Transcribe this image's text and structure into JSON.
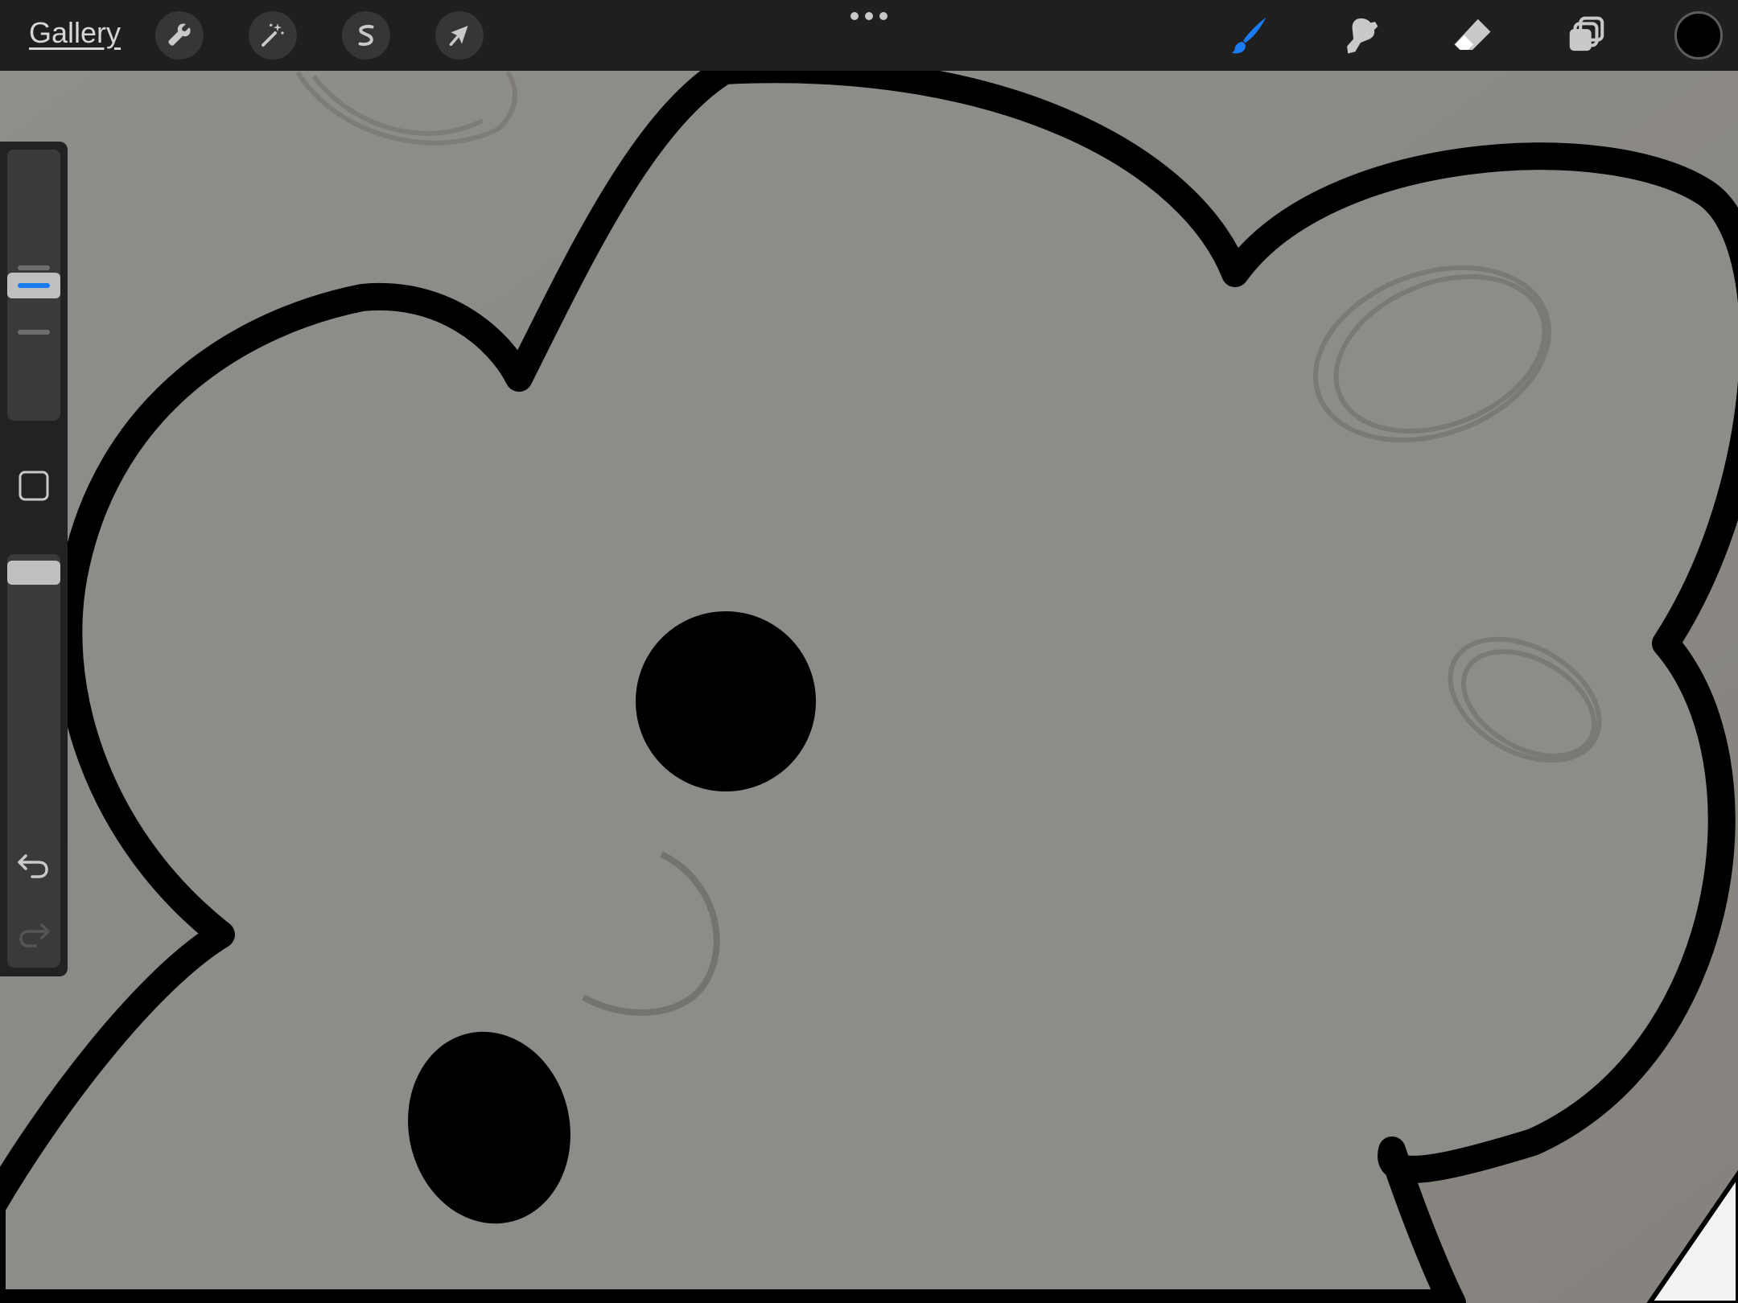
{
  "toolbar": {
    "gallery_label": "Gallery",
    "left_tools": [
      {
        "name": "actions",
        "icon": "wrench-icon"
      },
      {
        "name": "adjustments",
        "icon": "magic-wand-icon"
      },
      {
        "name": "selection",
        "icon": "selection-s-icon"
      },
      {
        "name": "transform",
        "icon": "arrow-cursor-icon"
      }
    ],
    "more_icon": "ellipsis-icon",
    "right_tools": [
      {
        "name": "brush",
        "icon": "brush-icon",
        "active": true
      },
      {
        "name": "smudge",
        "icon": "smudge-icon",
        "active": false
      },
      {
        "name": "eraser",
        "icon": "eraser-icon",
        "active": false
      },
      {
        "name": "layers",
        "icon": "layers-icon",
        "active": false
      }
    ],
    "current_color": "#000000"
  },
  "sidebar": {
    "brush_size_level": 0.5,
    "brush_opacity_level": 1.0,
    "modify_icon": "square-icon",
    "undo_icon": "undo-arrow-icon",
    "redo_icon": "redo-arrow-icon"
  },
  "colors": {
    "accent": "#1a7cf5",
    "toolbar_bg": "#1f1f1f",
    "sidebar_bg": "#222222",
    "canvas_paper": "#8c8a86",
    "ink": "#000000"
  }
}
